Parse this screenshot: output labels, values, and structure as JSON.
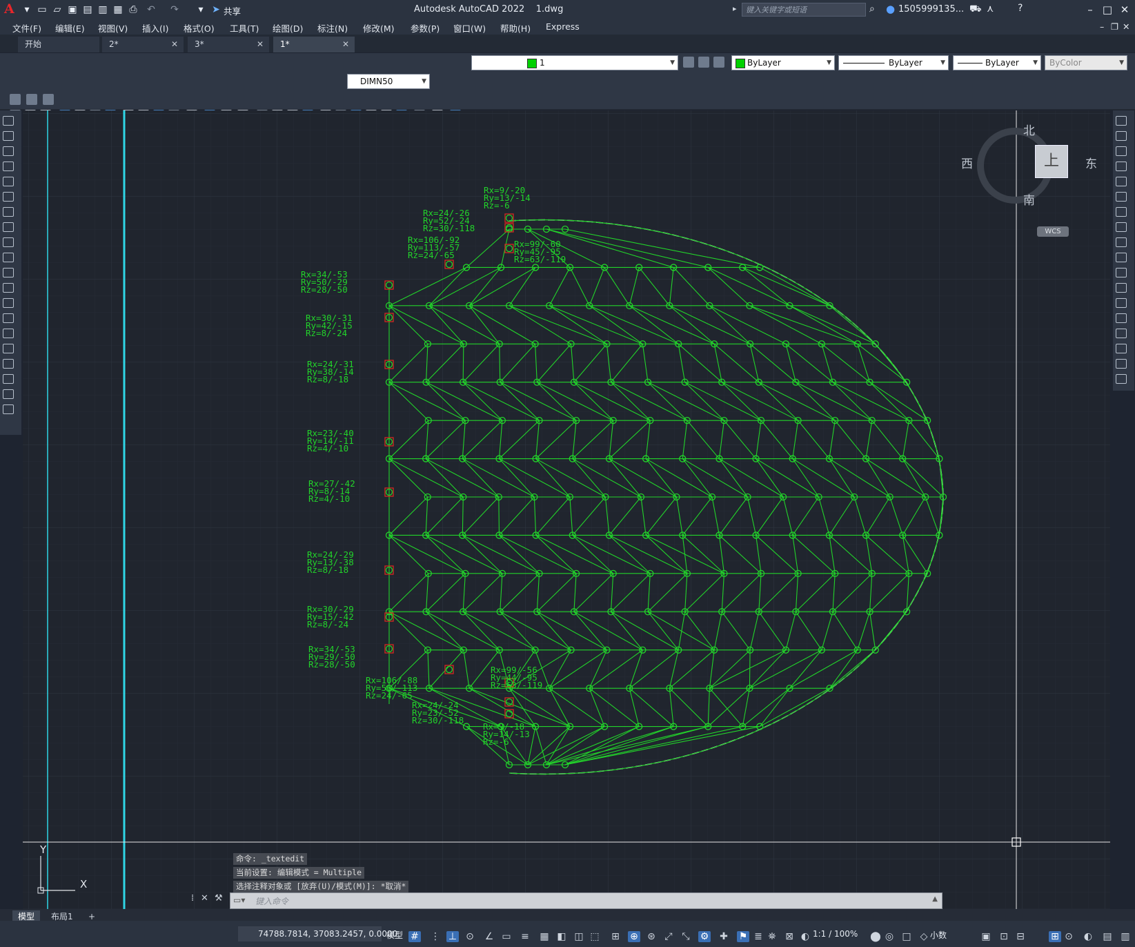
{
  "title_bar": {
    "logo": "A",
    "app_title": "Autodesk AutoCAD 2022",
    "file_name": "1.dwg",
    "share_label": "共享",
    "search_placeholder": "键入关键字或短语",
    "user_name": "1505999135..."
  },
  "menu": [
    "文件(F)",
    "编辑(E)",
    "视图(V)",
    "插入(I)",
    "格式(O)",
    "工具(T)",
    "绘图(D)",
    "标注(N)",
    "修改(M)",
    "参数(P)",
    "窗口(W)",
    "帮助(H)",
    "Express"
  ],
  "tabs": [
    {
      "label": "开始",
      "closable": false
    },
    {
      "label": "2*",
      "closable": true
    },
    {
      "label": "3*",
      "closable": true
    },
    {
      "label": "1*",
      "closable": true,
      "active": true
    }
  ],
  "properties": {
    "layer": "1",
    "layer_color": "#00d000",
    "color": "ByLayer",
    "linetype": "ByLayer",
    "lineweight": "ByLayer",
    "plot_style": "ByColor",
    "dim_style": "DIMN50"
  },
  "viewcube": {
    "north": "北",
    "south": "南",
    "east": "东",
    "west": "西",
    "top": "上",
    "ucs": "WCS"
  },
  "ucs_icon": {
    "y": "Y",
    "x": "X"
  },
  "annotations": [
    {
      "rx": "Rx=9/-20",
      "ry": "Ry=13/-14",
      "rz": "Rz=-6"
    },
    {
      "rx": "Rx=24/-26",
      "ry": "Ry=52/-24",
      "rz": "Rz=30/-118"
    },
    {
      "rx": "Rx=99/-60",
      "ry": "Ry=45/-95",
      "rz": "Rz=63/-119"
    },
    {
      "rx": "Rx=106/-92",
      "ry": "Ry=113/-57",
      "rz": "Rz=24/-65"
    },
    {
      "rx": "Rx=34/-53",
      "ry": "Ry=50/-29",
      "rz": "Rz=28/-50"
    },
    {
      "rx": "Rx=30/-31",
      "ry": "Ry=42/-15",
      "rz": "Rz=8/-24"
    },
    {
      "rx": "Rx=24/-31",
      "ry": "Ry=38/-14",
      "rz": "Rz=8/-18"
    },
    {
      "rx": "Rx=23/-40",
      "ry": "Ry=14/-11",
      "rz": "Rz=4/-10"
    },
    {
      "rx": "Rx=27/-42",
      "ry": "Ry=8/-14",
      "rz": "Rz=4/-10"
    },
    {
      "rx": "Rx=24/-29",
      "ry": "Ry=13/-38",
      "rz": "Rz=8/-18"
    },
    {
      "rx": "Rx=30/-29",
      "ry": "Ry=15/-42",
      "rz": "Rz=8/-24"
    },
    {
      "rx": "Rx=34/-53",
      "ry": "Ry=29/-50",
      "rz": "Rz=28/-50"
    },
    {
      "rx": "Rx=99/-56",
      "ry": "Ry=44/-95",
      "rz": "Rz=63/-119"
    },
    {
      "rx": "Rx=106/-88",
      "ry": "Ry=56/-113",
      "rz": "Rz=24/-65"
    },
    {
      "rx": "Rx=24/-24",
      "ry": "Ry=23/-52",
      "rz": "Rz=30/-118"
    },
    {
      "rx": "Rx=9/-18",
      "ry": "Ry=14/-13",
      "rz": "Rz=-6"
    }
  ],
  "command": {
    "history": [
      "命令: _textedit",
      "当前设置: 编辑模式 = Multiple",
      "选择注释对象或 [放弃(U)/模式(M)]: *取消*"
    ],
    "placeholder": "键入命令"
  },
  "layout_tabs": [
    "模型",
    "布局1"
  ],
  "status": {
    "coordinates": "74788.7814, 37083.2457, 0.0000",
    "space": "模型",
    "annotation_scale": "1:1 / 100%",
    "units": "小数"
  }
}
